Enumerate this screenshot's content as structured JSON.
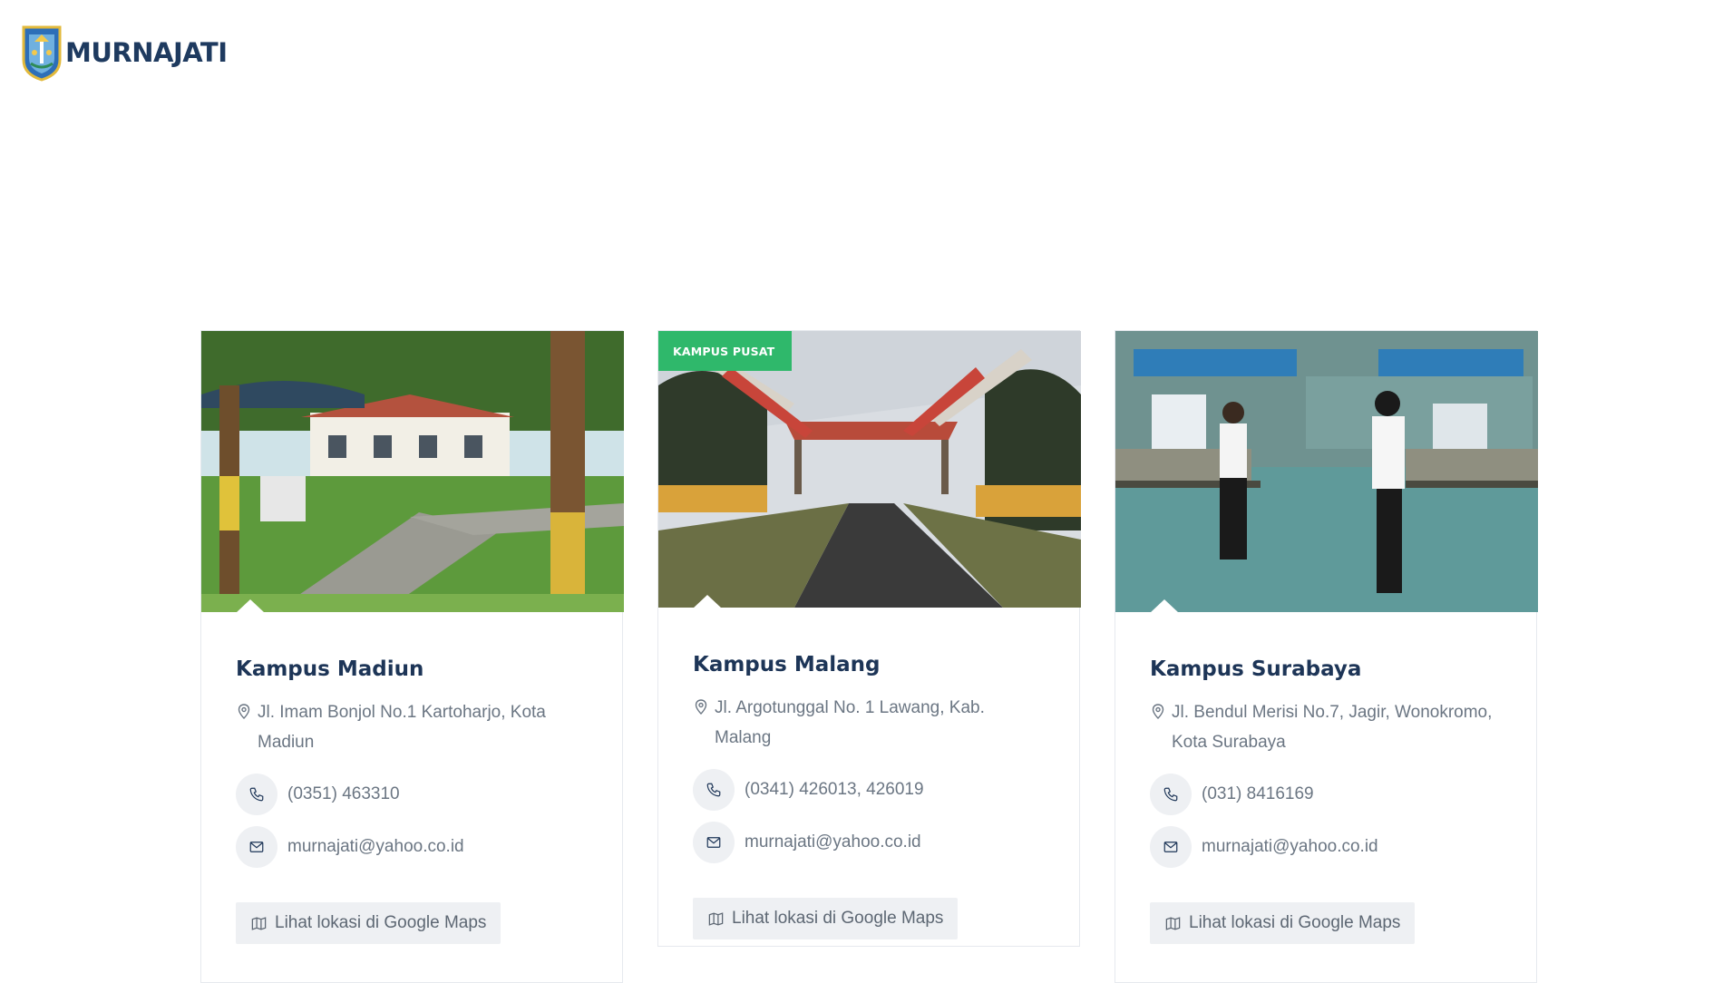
{
  "brand": {
    "name": "MURNAJATI"
  },
  "campuses": [
    {
      "title": "Kampus Madiun",
      "badge": "",
      "address": "Jl. Imam Bonjol No.1 Kartoharjo, Kota Madiun",
      "phone": "(0351) 463310",
      "email": "murnajati@yahoo.co.id",
      "maps_label": "Lihat lokasi di Google Maps"
    },
    {
      "title": "Kampus Malang",
      "badge": "KAMPUS PUSAT",
      "address": "Jl. Argotunggal No. 1 Lawang, Kab. Malang",
      "phone": "(0341) 426013, 426019",
      "email": "murnajati@yahoo.co.id",
      "maps_label": "Lihat lokasi di Google Maps"
    },
    {
      "title": "Kampus Surabaya",
      "badge": "",
      "address": "Jl. Bendul Merisi No.7, Jagir, Wonokromo, Kota Surabaya",
      "phone": "(031) 8416169",
      "email": "murnajati@yahoo.co.id",
      "maps_label": "Lihat lokasi di Google Maps"
    }
  ],
  "icons": {
    "logo": "east-java-emblem-icon",
    "address": "map-pin-icon",
    "phone": "phone-icon",
    "email": "mail-icon",
    "maps": "map-icon"
  },
  "colors": {
    "title": "#1d3557",
    "text_muted": "#6b7683",
    "badge_bg": "#2fb86b",
    "button_bg": "#eef0f3"
  }
}
